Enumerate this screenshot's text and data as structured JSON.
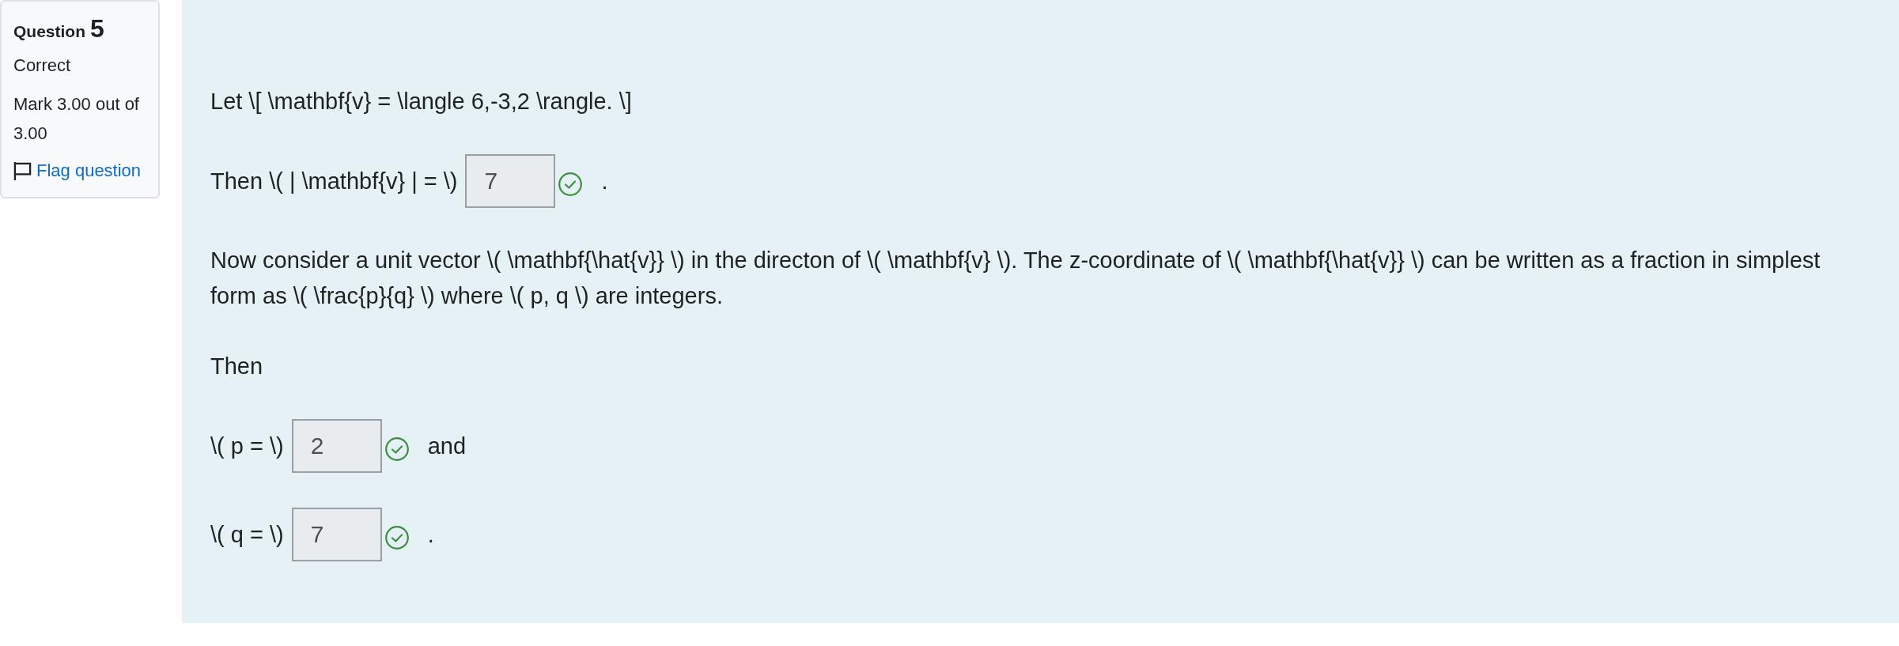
{
  "question_info": {
    "label": "Question",
    "number": "5",
    "state": "Correct",
    "grade": "Mark 3.00 out of 3.00",
    "flag": {
      "label": "Flag question",
      "flagged": false
    }
  },
  "formulation": {
    "blocks": [
      {
        "kind": "text",
        "text": "Let \\[ \\mathbf{v} = \\langle 6,-3,2 \\rangle. \\]"
      },
      {
        "kind": "answer_row",
        "parts": [
          {
            "kind": "text",
            "text": "Then \\( | \\mathbf{v} | = \\)"
          },
          {
            "kind": "answer",
            "value": "7",
            "correct": true
          },
          {
            "kind": "text",
            "text": "."
          }
        ]
      },
      {
        "kind": "text",
        "text": "Now consider a unit vector \\( \\mathbf{\\hat{v}} \\) in the directon of \\( \\mathbf{v} \\). The z-coordinate of \\( \\mathbf{\\hat{v}} \\) can be written as a fraction in simplest form as \\( \\frac{p}{q} \\) where \\( p, q \\) are integers."
      },
      {
        "kind": "text",
        "text": "Then"
      },
      {
        "kind": "answer_row",
        "parts": [
          {
            "kind": "text",
            "text": "\\( p = \\)"
          },
          {
            "kind": "answer",
            "value": "2",
            "correct": true
          },
          {
            "kind": "text",
            "text": "and"
          }
        ]
      },
      {
        "kind": "answer_row",
        "parts": [
          {
            "kind": "text",
            "text": "\\( q = \\)"
          },
          {
            "kind": "answer",
            "value": "7",
            "correct": true
          },
          {
            "kind": "text",
            "text": "."
          }
        ]
      }
    ]
  }
}
